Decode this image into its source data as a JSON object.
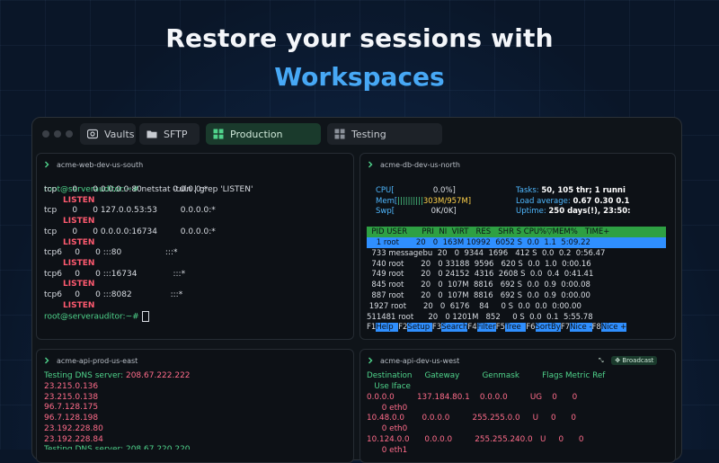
{
  "hero": {
    "line1": "Restore your sessions with",
    "line2": "Workspaces"
  },
  "tabs": [
    {
      "label": "Vaults",
      "icon": "vault-icon"
    },
    {
      "label": "SFTP",
      "icon": "folder-icon"
    },
    {
      "label": "Production",
      "icon": "grid-icon",
      "active": true
    },
    {
      "label": "Testing",
      "icon": "grid-icon"
    }
  ],
  "panes": {
    "web": {
      "title": "acme-web-dev-us-south",
      "prompt": "root@serverauditor:~# ",
      "command": "netstat -tuln | grep 'LISTEN'",
      "rows": [
        {
          "proto": "tcp",
          "recv": "0",
          "send": "0",
          "local": "0.0.0.0:80",
          "foreign": "0.0.0.0:*",
          "state": "LISTEN"
        },
        {
          "proto": "tcp",
          "recv": "0",
          "send": "0",
          "local": "127.0.0.53:53",
          "foreign": "0.0.0.0:*",
          "state": "LISTEN"
        },
        {
          "proto": "tcp",
          "recv": "0",
          "send": "0",
          "local": "0.0.0.0:16734",
          "foreign": "0.0.0.0:*",
          "state": "LISTEN"
        },
        {
          "proto": "tcp6",
          "recv": "0",
          "send": "0",
          "local": ":::80",
          "foreign": ":::*",
          "state": "LISTEN"
        },
        {
          "proto": "tcp6",
          "recv": "0",
          "send": "0",
          "local": ":::16734",
          "foreign": ":::*",
          "state": "LISTEN"
        },
        {
          "proto": "tcp6",
          "recv": "0",
          "send": "0",
          "local": ":::8082",
          "foreign": ":::*",
          "state": "LISTEN"
        }
      ],
      "final_prompt": "root@serverauditor:~# "
    },
    "db": {
      "title": "acme-db-dev-us-north",
      "cpu_label": "CPU[",
      "cpu_value": "0.0%]",
      "mem_label": "Mem[",
      "mem_bars": "||||||||||",
      "mem_value": "303M/957M]",
      "swp_label": "Swp[",
      "swp_value": "0K/0K]",
      "tasks_label": "Tasks: ",
      "tasks_value": "50, 105 thr; 1 runni",
      "load_label": "Load average: ",
      "load_value": "0.67 0.30 0.1",
      "uptime_label": "Uptime: ",
      "uptime_value": "250 days(!), 23:50:",
      "header": "  PID USER      PRI  NI  VIRT   RES   SHR S CPU%▽MEM%   TIME+",
      "processes": [
        "    1 root       20   0  163M 10992  6052 S  0.0  1.1  5:09.22",
        "  733 messagebu  20   0  9344  1696   412 S  0.0  0.2  0:56.47",
        "  740 root       20   0 33188  9596   620 S  0.0  1.0  0:00.16",
        "  749 root       20   0 24152  4316  2608 S  0.0  0.4  0:41.41",
        "  845 root       20   0  107M  8816   692 S  0.0  0.9  0:00.08",
        "  887 root       20   0  107M  8816   692 S  0.0  0.9  0:00.00",
        " 1927 root       20   0  6176    84     0 S  0.0  0.0  0:00.00",
        "511481 root      20   0 1201M   852     0 S  0.0  0.1  5:55.78"
      ],
      "fkeys": [
        {
          "key": "F1",
          "label": "Help  "
        },
        {
          "key": "F2",
          "label": "Setup "
        },
        {
          "key": "F3",
          "label": "Search"
        },
        {
          "key": "F4",
          "label": "Filter"
        },
        {
          "key": "F5",
          "label": "Tree  "
        },
        {
          "key": "F6",
          "label": "SortBy"
        },
        {
          "key": "F7",
          "label": "Nice -"
        },
        {
          "key": "F8",
          "label": "Nice +"
        }
      ]
    },
    "api_east": {
      "title": "acme-api-prod-us-east",
      "server_line_label": "Testing DNS server: ",
      "server_line_value": "208.67.222.222",
      "ips": [
        "23.215.0.136",
        "23.215.0.138",
        "96.7.128.175",
        "96.7.128.198",
        "23.192.228.80",
        "23.192.228.84"
      ],
      "cut_line": "Testing DNS server: 208.67.220.220"
    },
    "api_west": {
      "title": "acme-api-dev-us-west",
      "broadcast": "Broadcast",
      "header": "Destination     Gateway         Genmask         Flags Metric Ref",
      "header2": "   Use Iface",
      "routes": [
        {
          "line": "0.0.0.0         137.184.80.1    0.0.0.0         UG    0      0",
          "iface": "      0 eth0"
        },
        {
          "line": "10.48.0.0       0.0.0.0         255.255.0.0     U     0      0",
          "iface": "      0 eth0"
        },
        {
          "line": "10.124.0.0      0.0.0.0         255.255.240.0   U     0      0",
          "iface": "      0 eth1"
        }
      ]
    }
  },
  "colors": {
    "accent": "#47a8f5",
    "green": "#4fd38b",
    "red": "#ff5a70",
    "htop_header_bg": "#2ea043",
    "htop_select_bg": "#2f8fff"
  }
}
